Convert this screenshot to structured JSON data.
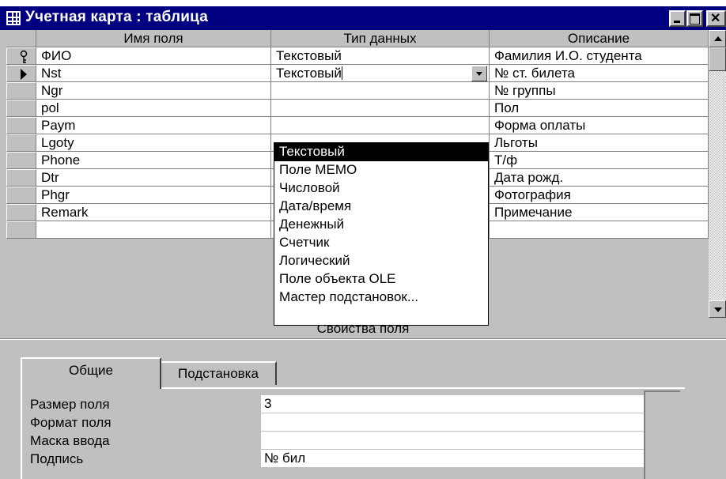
{
  "window": {
    "title": "Учетная карта : таблица"
  },
  "grid": {
    "columns": [
      "Имя поля",
      "Тип данных",
      "Описание"
    ],
    "rows": [
      {
        "name": "ФИО",
        "type": "Текстовый",
        "desc": "Фамилия И.О. студента",
        "selector": "key-icon"
      },
      {
        "name": "Nst",
        "type": "Текстовый",
        "desc": "№ ст. билета",
        "selector": "current-row-arrow-icon"
      },
      {
        "name": "Ngr",
        "type": "",
        "desc": "№ группы"
      },
      {
        "name": "pol",
        "type": "",
        "desc": "Пол"
      },
      {
        "name": "Paym",
        "type": "",
        "desc": "Форма оплаты"
      },
      {
        "name": "Lgoty",
        "type": "",
        "desc": "Льготы"
      },
      {
        "name": "Phone",
        "type": "",
        "desc": "Т/ф"
      },
      {
        "name": "Dtr",
        "type": "",
        "desc": "Дата рожд."
      },
      {
        "name": "Phgr",
        "type": "",
        "desc": "Фотография"
      },
      {
        "name": "Remark",
        "type": "",
        "desc": "Примечание"
      },
      {
        "name": "",
        "type": "",
        "desc": ""
      }
    ]
  },
  "dropdown": {
    "selected": "Текстовый",
    "options": [
      "Текстовый",
      "Поле MEMO",
      "Числовой",
      "Дата/время",
      "Денежный",
      "Счетчик",
      "Логический",
      "Поле объекта OLE",
      "Мастер подстановок..."
    ]
  },
  "properties": {
    "caption": "Свойства поля",
    "tabs": [
      "Общие",
      "Подстановка"
    ],
    "active_tab": "Общие",
    "items": [
      {
        "label": "Размер поля",
        "value": "3"
      },
      {
        "label": "Формат поля",
        "value": ""
      },
      {
        "label": "Маска ввода",
        "value": ""
      },
      {
        "label": "Подпись",
        "value": "№ бил"
      }
    ]
  },
  "colors": {
    "titlebar": "#000080",
    "face": "#c0c0c0",
    "selection": "#000000"
  }
}
